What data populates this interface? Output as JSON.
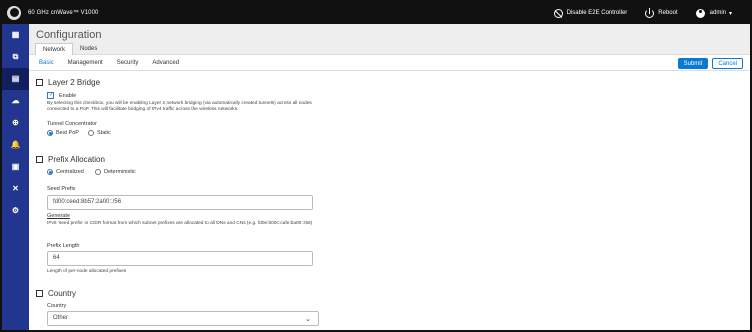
{
  "app": {
    "title": "60 GHz cnWave™ V1000",
    "actions": {
      "disable_e2e": "Disable E2E Controller",
      "reboot": "Reboot",
      "user": "admin"
    }
  },
  "sidebar": {
    "items": [
      {
        "icon": "dashboard-icon",
        "symbol": "▦"
      },
      {
        "icon": "pages-icon",
        "symbol": "⧉"
      },
      {
        "icon": "document-icon",
        "symbol": "▤"
      },
      {
        "icon": "cloud-upload-icon",
        "symbol": "☁"
      },
      {
        "icon": "crosshair-icon",
        "symbol": "⊕"
      },
      {
        "icon": "bell-icon",
        "symbol": "🔔"
      },
      {
        "icon": "calendar-icon",
        "symbol": "▣"
      },
      {
        "icon": "tools-icon",
        "symbol": "✕"
      },
      {
        "icon": "settings-icon",
        "symbol": "⚙"
      }
    ]
  },
  "page": {
    "title": "Configuration",
    "tabs": [
      "Network",
      "Nodes"
    ],
    "subtabs": [
      "Basic",
      "Management",
      "Security",
      "Advanced"
    ],
    "submit": "Submit",
    "cancel": "Cancel"
  },
  "layer2": {
    "title": "Layer 2 Bridge",
    "enable_label": "Enable",
    "description": "By selecting this checkbox, you will be enabling Layer 2 network bridging (via automatically created tunnels) across all nodes connected to a PoP. This will facilitate bridging of IPv4 traffic across the wireless networks.",
    "tunnel_label": "Tunnel Concentrator",
    "option_best": "Best PoP",
    "option_static": "Static"
  },
  "prefix": {
    "title": "Prefix Allocation",
    "option_centralized": "Centralized",
    "option_deterministic": "Deterministic",
    "seed_label": "Seed Prefix",
    "seed_value": "fd00:ceed:8b57:2a00::/56",
    "generate": "Generate",
    "help": "IPv6 'seed prefix' in CIDR format from which subnet prefixes are allocated to all DNs and CNs (e.g. fd0e:b00c:cafe:ba00::/56)",
    "length_label": "Prefix Length",
    "length_value": "64",
    "length_help": "Length of per-node allocated prefixes"
  },
  "country": {
    "title": "Country",
    "label": "Country",
    "value": "Other"
  }
}
